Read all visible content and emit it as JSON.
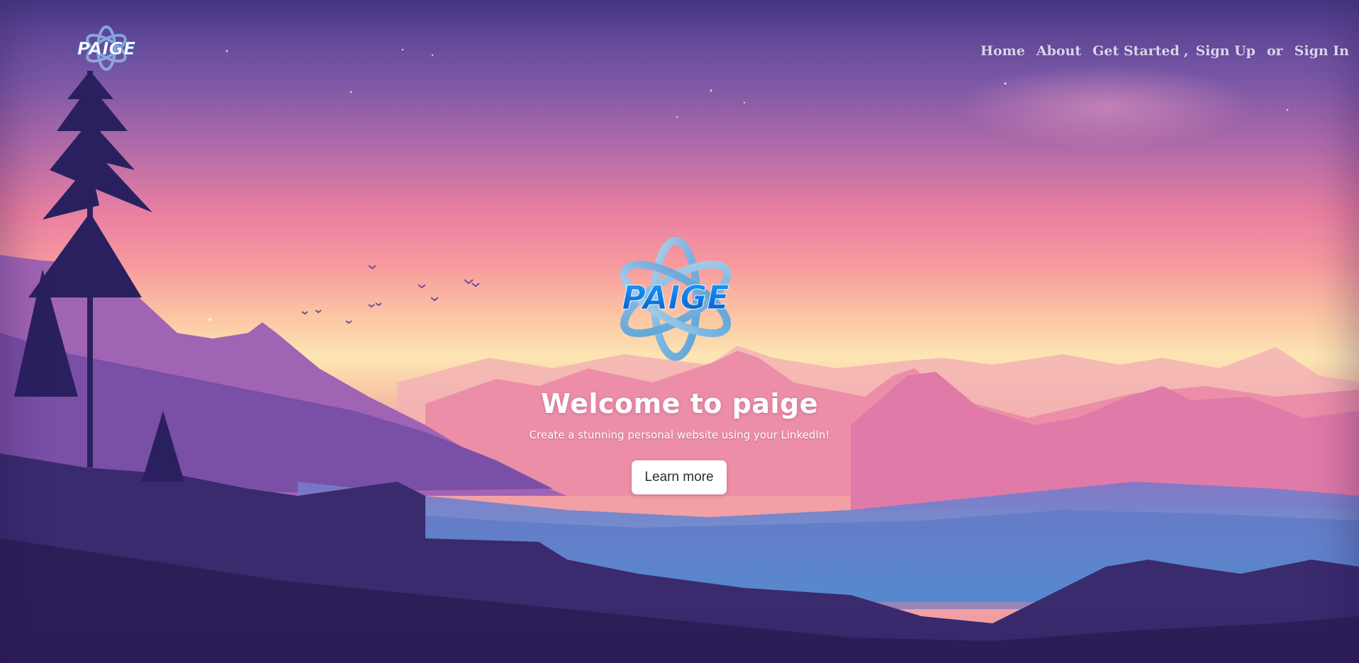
{
  "brand": {
    "logo_text": "PAIGE"
  },
  "navbar": {
    "links": [
      {
        "label": "Home"
      },
      {
        "label": "About"
      },
      {
        "label": "Get Started"
      },
      {
        "label": "Sign Up"
      },
      {
        "label": "Sign In"
      }
    ],
    "separator": ",",
    "or_text": "or"
  },
  "hero": {
    "logo_text": "PAIGE",
    "title": "Welcome to paige",
    "subtitle": "Create a stunning personal website using your LinkedIn!",
    "cta_label": "Learn more"
  },
  "colors": {
    "nav_text": "#dcd3ea",
    "logo_blue": "#1f7fe0",
    "button_bg": "#ffffff"
  },
  "icons": [
    "atom-logo-icon"
  ]
}
